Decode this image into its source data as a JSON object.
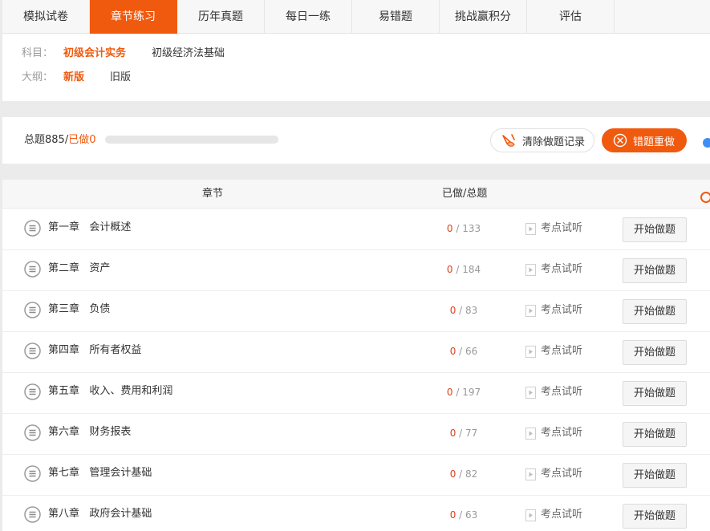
{
  "tabs": [
    {
      "label": "模拟试卷"
    },
    {
      "label": "章节练习"
    },
    {
      "label": "历年真题"
    },
    {
      "label": "每日一练"
    },
    {
      "label": "易错题"
    },
    {
      "label": "挑战赢积分"
    },
    {
      "label": "评估"
    }
  ],
  "active_tab": "章节练习",
  "filter": {
    "subject_label": "科目：",
    "subjects": [
      "初级会计实务",
      "初级经济法基础"
    ],
    "selected_subject": "初级会计实务",
    "outline_label": "大纲：",
    "outlines": [
      "新版",
      "旧版"
    ],
    "selected_outline": "新版"
  },
  "stats": {
    "total_text": "总题885/",
    "done_text": "已做0",
    "progress_fraction": 0,
    "clear_label": "清除做题记录",
    "redo_label": "错题重做"
  },
  "table": {
    "col_chapter": "章节",
    "col_progress": "已做/总题",
    "rows": [
      {
        "chapter": "第一章",
        "title": "会计概述",
        "done": "0",
        "total": "/ 133",
        "preview": "考点试听",
        "action": "开始做题"
      },
      {
        "chapter": "第二章",
        "title": "资产",
        "done": "0",
        "total": "/ 184",
        "preview": "考点试听",
        "action": "开始做题"
      },
      {
        "chapter": "第三章",
        "title": "负债",
        "done": "0",
        "total": "/ 83",
        "preview": "考点试听",
        "action": "开始做题"
      },
      {
        "chapter": "第四章",
        "title": "所有者权益",
        "done": "0",
        "total": "/ 66",
        "preview": "考点试听",
        "action": "开始做题"
      },
      {
        "chapter": "第五章",
        "title": "收入、费用和利润",
        "done": "0",
        "total": "/ 197",
        "preview": "考点试听",
        "action": "开始做题"
      },
      {
        "chapter": "第六章",
        "title": "财务报表",
        "done": "0",
        "total": "/ 77",
        "preview": "考点试听",
        "action": "开始做题"
      },
      {
        "chapter": "第七章",
        "title": "管理会计基础",
        "done": "0",
        "total": "/ 82",
        "preview": "考点试听",
        "action": "开始做题"
      },
      {
        "chapter": "第八章",
        "title": "政府会计基础",
        "done": "0",
        "total": "/ 63",
        "preview": "考点试听",
        "action": "开始做题"
      }
    ]
  },
  "icons": {
    "chapter": "list-circle-icon",
    "preview": "play-icon",
    "clear": "clear-brush-icon",
    "redo": "close-circle-icon"
  },
  "colors": {
    "accent": "#f05a0e",
    "done_count": "#e0401a",
    "blue_dot": "#3e8ef7"
  }
}
